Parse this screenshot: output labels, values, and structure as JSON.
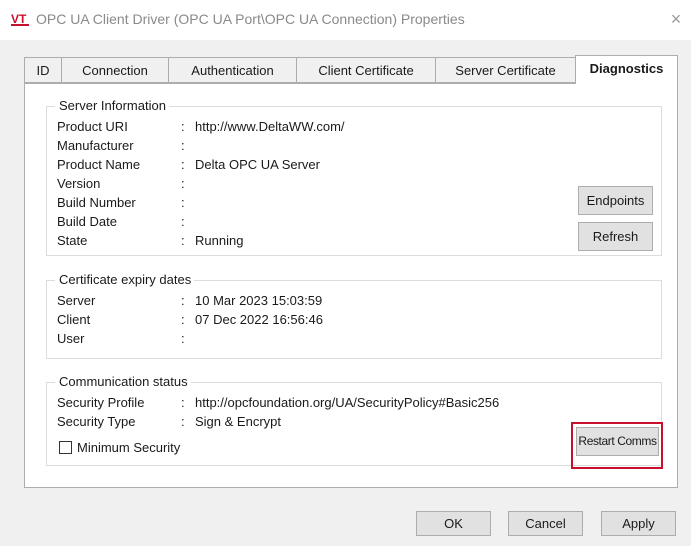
{
  "window": {
    "title": "OPC UA Client Driver (OPC UA Port\\OPC UA Connection) Properties",
    "app_icon": "vt-logo-icon",
    "close_glyph": "×"
  },
  "tabs": [
    {
      "label": "ID"
    },
    {
      "label": "Connection"
    },
    {
      "label": "Authentication"
    },
    {
      "label": "Client Certificate"
    },
    {
      "label": "Server Certificate"
    },
    {
      "label": "Diagnostics",
      "active": true
    }
  ],
  "server_info": {
    "title": "Server Information",
    "rows": [
      {
        "label": "Product URI",
        "value": "http://www.DeltaWW.com/"
      },
      {
        "label": "Manufacturer",
        "value": ""
      },
      {
        "label": "Product Name",
        "value": "Delta OPC UA Server"
      },
      {
        "label": "Version",
        "value": ""
      },
      {
        "label": "Build Number",
        "value": ""
      },
      {
        "label": "Build Date",
        "value": ""
      },
      {
        "label": "State",
        "value": "Running"
      }
    ],
    "endpoints_label": "Endpoints",
    "refresh_label": "Refresh"
  },
  "cert_expiry": {
    "title": "Certificate expiry dates",
    "rows": [
      {
        "label": "Server",
        "value": "10 Mar 2023 15:03:59"
      },
      {
        "label": "Client",
        "value": "07 Dec 2022 16:56:46"
      },
      {
        "label": "User",
        "value": ""
      }
    ]
  },
  "comm_status": {
    "title": "Communication status",
    "rows": [
      {
        "label": "Security Profile",
        "value": "http://opcfoundation.org/UA/SecurityPolicy#Basic256"
      },
      {
        "label": "Security Type",
        "value": "Sign & Encrypt"
      }
    ],
    "min_security_label": "Minimum Security",
    "min_security_checked": false,
    "restart_label": "Restart Comms"
  },
  "footer": {
    "ok_label": "OK",
    "cancel_label": "Cancel",
    "apply_label": "Apply"
  },
  "colon": ":",
  "highlight_color": "#c8102e"
}
